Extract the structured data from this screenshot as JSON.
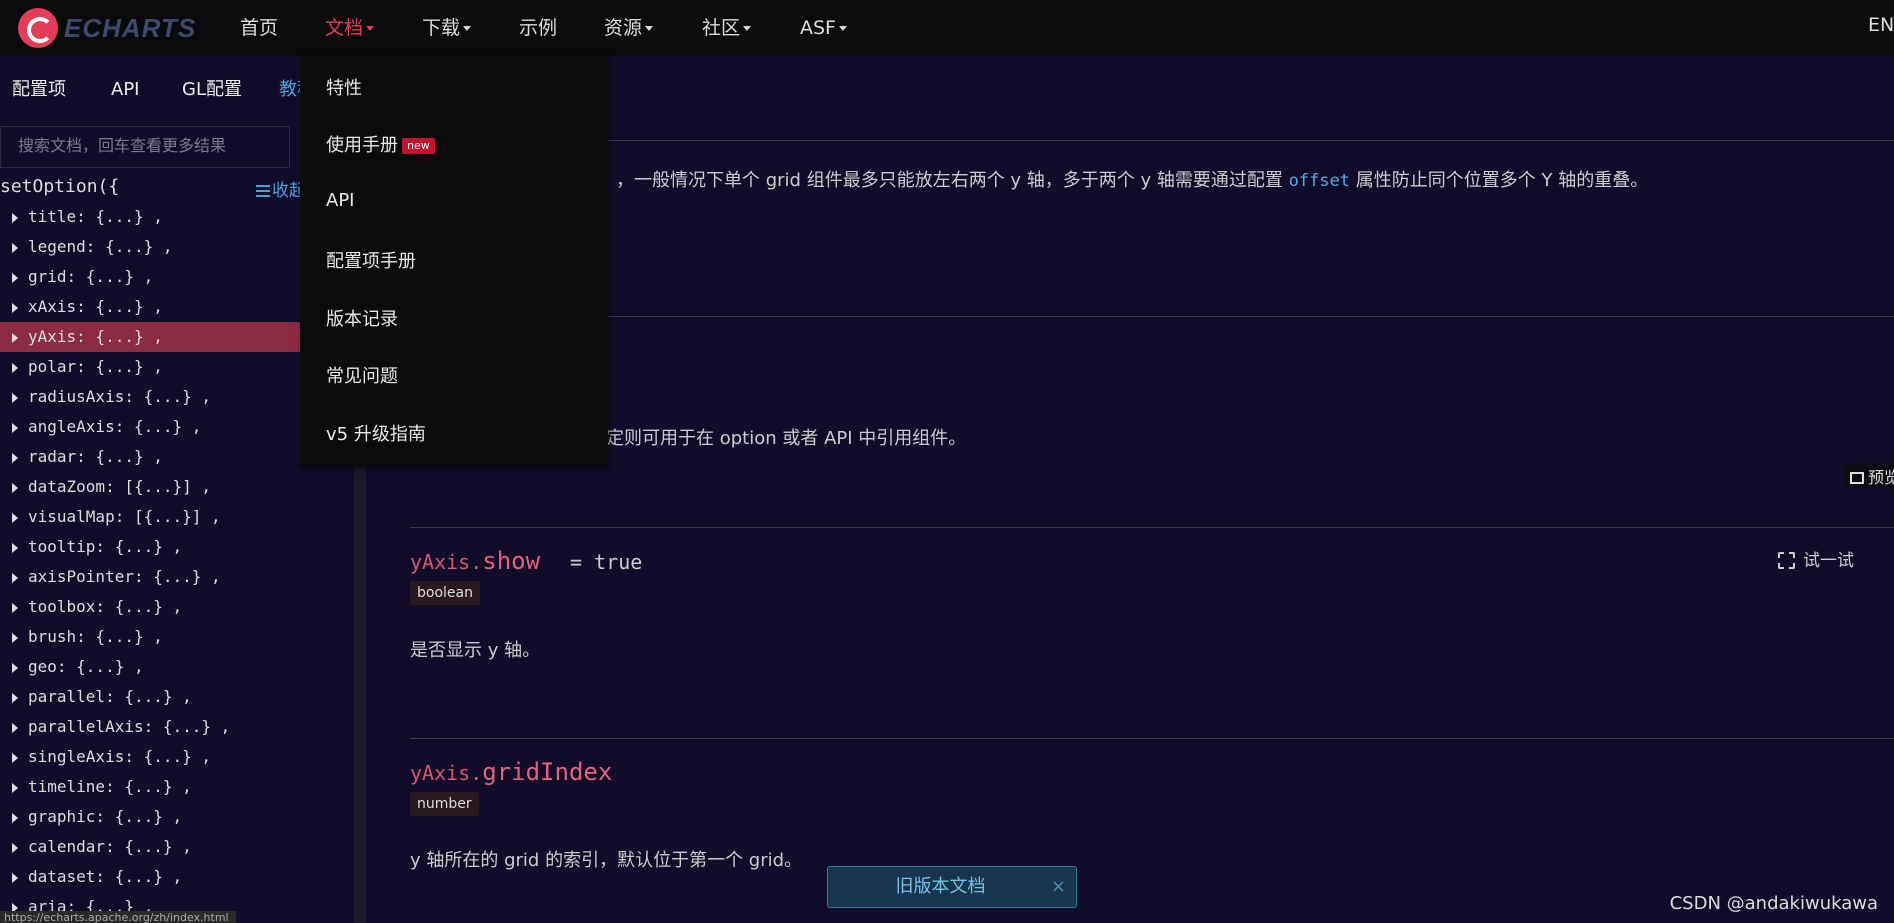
{
  "nav": {
    "logo_text": "ECHARTS",
    "items": [
      {
        "label": "首页",
        "caret": false
      },
      {
        "label": "文档",
        "caret": true
      },
      {
        "label": "下载",
        "caret": true
      },
      {
        "label": "示例",
        "caret": false
      },
      {
        "label": "资源",
        "caret": true
      },
      {
        "label": "社区",
        "caret": true
      },
      {
        "label": "ASF",
        "caret": true
      }
    ],
    "lang": "EN",
    "accent_color": "#e43c59"
  },
  "sidebar": {
    "tabs": [
      "配置项",
      "API",
      "GL配置",
      "教程"
    ],
    "search_placeholder": "搜索文档，回车查看更多结果",
    "root": "setOption({",
    "collapse_label": "收起",
    "tree": [
      "title: {...} ,",
      "legend: {...} ,",
      "grid: {...} ,",
      "xAxis: {...} ,",
      "yAxis: {...} ,",
      "polar: {...} ,",
      "radiusAxis: {...} ,",
      "angleAxis: {...} ,",
      "radar: {...} ,",
      "dataZoom: [{...}] ,",
      "visualMap: [{...}] ,",
      "tooltip: {...} ,",
      "axisPointer: {...} ,",
      "toolbox: {...} ,",
      "brush: {...} ,",
      "geo: {...} ,",
      "parallel: {...} ,",
      "parallelAxis: {...} ,",
      "singleAxis: {...} ,",
      "timeline: {...} ,",
      "graphic: {...} ,",
      "calendar: {...} ,",
      "dataset: {...} ,",
      "aria: {...} ,"
    ],
    "selected_index": 4,
    "status_url": "https://echarts.apache.org/zh/index.html"
  },
  "dropdown": {
    "items": [
      {
        "label": "特性",
        "badge": ""
      },
      {
        "label": "使用手册",
        "badge": "new"
      },
      {
        "label": "API",
        "badge": ""
      },
      {
        "label": "配置项手册",
        "badge": ""
      },
      {
        "label": "版本记录",
        "badge": ""
      },
      {
        "label": "常见问题",
        "badge": ""
      },
      {
        "label": "v5 升级指南",
        "badge": ""
      }
    ]
  },
  "main": {
    "intro_text_a": "，一般情况下单个 grid 组件最多只能放左右两个 y 轴，多于两个 y 轴需要通过配置 ",
    "intro_code": "offset",
    "intro_text_b": " 属性防止同个位置多个 Y 轴的重叠。",
    "id_text": "定则可用于在 option 或者 API 中引用组件。",
    "preview_label": "预览",
    "try_label": "试一试",
    "options": [
      {
        "prefix": "yAxis.",
        "name": "show",
        "default": "= true",
        "type": "boolean",
        "desc": "是否显示 y 轴。"
      },
      {
        "prefix": "yAxis.",
        "name": "gridIndex",
        "default": "",
        "type": "number",
        "desc": "y 轴所在的 grid 的索引，默认位于第一个 grid。"
      }
    ]
  },
  "legacy_bar": {
    "label": "旧版本文档",
    "close": "×"
  },
  "watermark": "CSDN @andakiwukawa"
}
